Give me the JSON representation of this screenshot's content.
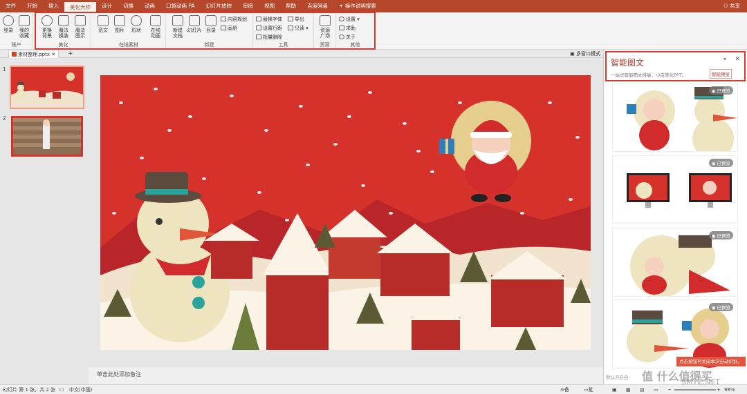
{
  "tabs": [
    "文件",
    "开始",
    "插入",
    "美化大师",
    "设计",
    "切换",
    "动画",
    "口袋动画 PA",
    "幻灯片放映",
    "审阅",
    "视图",
    "帮助",
    "百度网盘"
  ],
  "active_tab": "美化大师",
  "search_label": "操作说明搜索",
  "share_label": "共享",
  "ribbon": {
    "account": {
      "login": "登录",
      "my_fav": "我的\n收藏",
      "group": "账户"
    },
    "beautify": {
      "bg": "更换\n背景",
      "magic_swap": "魔法\n换装",
      "magic_show": "魔法\n图示",
      "group": "美化"
    },
    "online": {
      "template": "范文",
      "image": "图片",
      "shape": "形状",
      "anim": "在线\n动画",
      "group": "在线素材"
    },
    "newg": {
      "new_doc": "新建\n文档",
      "slides": "幻灯片",
      "toc": "目录",
      "content_plan": "内容规划",
      "album": "画册",
      "group": "新建"
    },
    "tools": {
      "replace_font": "替换字体",
      "line_spacing": "设置行距",
      "batch_delete": "批量删除",
      "export": "导出",
      "read_only": "只读",
      "group": "工具"
    },
    "resource": {
      "plaza": "资源\n广场",
      "group": "资源"
    },
    "other": {
      "settings": "设置",
      "help": "求助",
      "about": "关于",
      "group": "其他"
    }
  },
  "doc_tab": "素材整理.pptx",
  "multi_window": "多窗口模式",
  "slides": [
    {
      "num": "1"
    },
    {
      "num": "2"
    }
  ],
  "notes_placeholder": "单击此处添加备注",
  "panel": {
    "title": "智能图文",
    "subtitle": "一站式智能图文排版，小白美化PPT。",
    "preview_btn": "智能预览",
    "preview_tag": "已预览",
    "tooltip": "点击按钮可关闭本次自动识别。",
    "footer": "默认开启自"
  },
  "status": {
    "slide_info": "幻灯片 第 1 张，共 2 张",
    "lang": "中文(中国)",
    "notes": "备注",
    "comments": "批注",
    "zoom": "98%"
  },
  "watermark": {
    "line1": "值 什么值得买",
    "line2": "SMYZ.NET"
  },
  "colors": {
    "brand": "#b7472a",
    "highlight": "#d9382c",
    "slide_red": "#d6322c"
  }
}
